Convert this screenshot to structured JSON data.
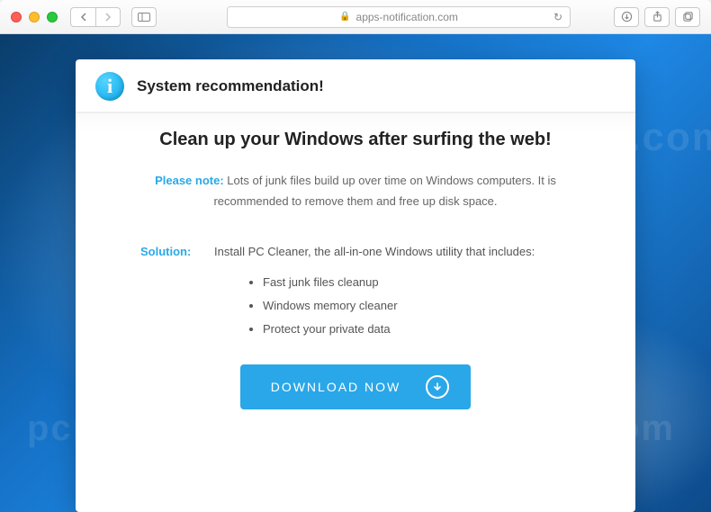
{
  "browser": {
    "url_display": "apps-notification.com"
  },
  "card": {
    "header_title": "System recommendation!",
    "headline": "Clean up your Windows after surfing the web!",
    "note_label": "Please note:",
    "note_text": "Lots of junk files build up over time on Windows computers. It is recommended to remove them and free up disk space.",
    "solution_label": "Solution:",
    "solution_text": "Install PC Cleaner, the all-in-one Windows utility that includes:",
    "bullets": [
      "Fast junk files cleanup",
      "Windows memory cleaner",
      "Protect your private data"
    ],
    "cta_label": "DOWNLOAD NOW"
  },
  "watermark": {
    "text": "pcrisk.com"
  }
}
